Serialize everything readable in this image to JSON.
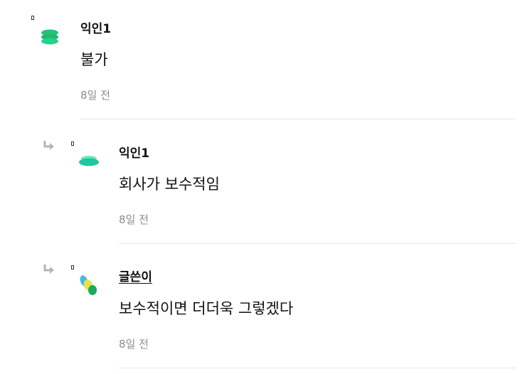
{
  "comments": [
    {
      "author": "익인1",
      "text": "불가",
      "time": "8일 전",
      "is_reply": false,
      "is_writer": false,
      "avatar_icon": "green-pill-stack-icon"
    },
    {
      "author": "익인1",
      "text": "회사가 보수적임",
      "time": "8일 전",
      "is_reply": true,
      "is_writer": false,
      "avatar_icon": "green-pill-stack-icon"
    },
    {
      "author": "글쓴이",
      "text": "보수적이면 더더욱 그렇겠다",
      "time": "8일 전",
      "is_reply": true,
      "is_writer": true,
      "avatar_icon": "tricolor-blob-icon"
    }
  ],
  "colors": {
    "avatar_green": "#27c27a",
    "avatar_teal": "#1fc7a0",
    "writer_blue": "#4fb6e3",
    "writer_yellow": "#e8e34a",
    "writer_green": "#1ea85a",
    "meta_gray": "#8c8c8c",
    "divider": "#e6e6e6"
  }
}
